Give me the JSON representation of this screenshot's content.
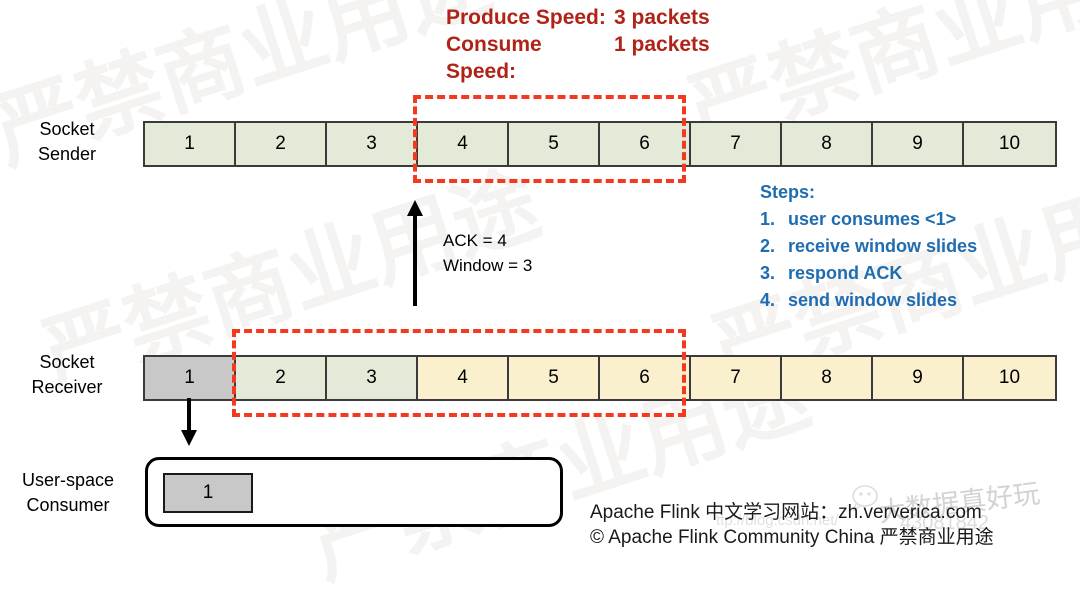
{
  "header": {
    "produce_label": "Produce Speed:",
    "produce_value": "3 packets",
    "consume_label": "Consume Speed:",
    "consume_value": "1 packets",
    "color": "#b02318"
  },
  "sender": {
    "label_line1": "Socket",
    "label_line2": "Sender",
    "cells": [
      {
        "value": "1",
        "state": "green"
      },
      {
        "value": "2",
        "state": "green"
      },
      {
        "value": "3",
        "state": "green"
      },
      {
        "value": "4",
        "state": "green"
      },
      {
        "value": "5",
        "state": "green"
      },
      {
        "value": "6",
        "state": "green"
      },
      {
        "value": "7",
        "state": "green"
      },
      {
        "value": "8",
        "state": "green"
      },
      {
        "value": "9",
        "state": "green"
      },
      {
        "value": "10",
        "state": "green"
      }
    ],
    "window_start_cell": 4,
    "window_end_cell": 6
  },
  "receiver": {
    "label_line1": "Socket",
    "label_line2": "Receiver",
    "cells": [
      {
        "value": "1",
        "state": "gray"
      },
      {
        "value": "2",
        "state": "green"
      },
      {
        "value": "3",
        "state": "green"
      },
      {
        "value": "4",
        "state": "yellow"
      },
      {
        "value": "5",
        "state": "yellow"
      },
      {
        "value": "6",
        "state": "yellow"
      },
      {
        "value": "7",
        "state": "yellow"
      },
      {
        "value": "8",
        "state": "yellow"
      },
      {
        "value": "9",
        "state": "yellow"
      },
      {
        "value": "10",
        "state": "yellow"
      }
    ],
    "window_start_cell": 2,
    "window_end_cell": 6
  },
  "ack": {
    "line1": "ACK = 4",
    "line2": "Window = 3"
  },
  "steps": {
    "title": "Steps:",
    "items": [
      {
        "num": "1.",
        "text": "user consumes <1>"
      },
      {
        "num": "2.",
        "text": "receive window slides"
      },
      {
        "num": "3.",
        "text": "respond ACK"
      },
      {
        "num": "4.",
        "text": "send window slides"
      }
    ],
    "color": "#1f6cb0"
  },
  "consumer": {
    "label_line1": "User-space",
    "label_line2": "Consumer",
    "cell_value": "1"
  },
  "footer": {
    "line1": "Apache Flink 中文学习网站：zh.ververica.com",
    "line2": "© Apache Flink Community China 严禁商业用途"
  },
  "watermarks": {
    "tile_text": "严禁商业用途",
    "brand": "大数据真好玩",
    "id": "43081842",
    "sub": "ttp://blog.csdn.net/"
  },
  "colors": {
    "green": "#e3ebd8",
    "yellow": "#faf0ce",
    "gray": "#c8c8c8",
    "dashed_red": "#f33a21",
    "border": "#3a3a3a"
  }
}
